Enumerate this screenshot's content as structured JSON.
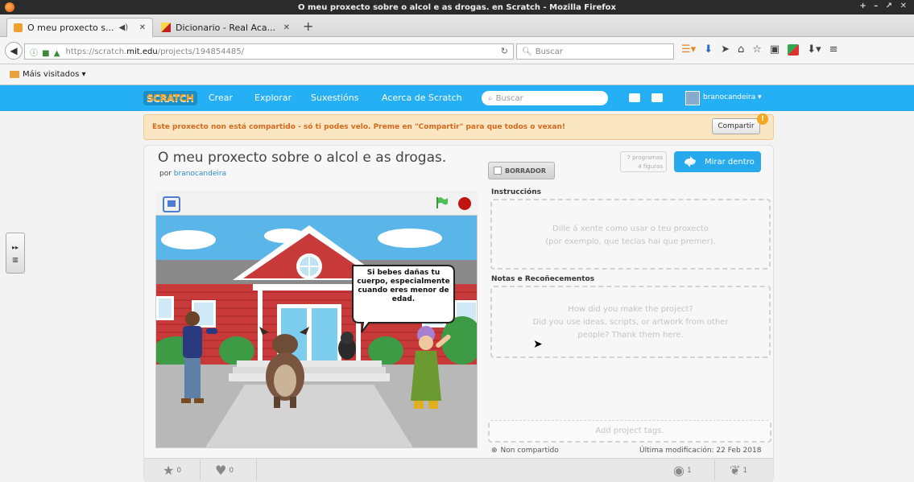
{
  "window": {
    "title": "O meu proxecto sobre o alcol e as drogas. en Scratch - Mozilla Firefox",
    "controls": "+ – ↗ ✕"
  },
  "tabs": [
    {
      "label": "O meu proxecto s...",
      "audio": "◀)",
      "close": "✕"
    },
    {
      "label": "Dicionario - Real Aca...",
      "close": "✕"
    }
  ],
  "new_tab": "+",
  "url": {
    "prefix": "https://scratch.",
    "host": "mit.edu",
    "path": "/projects/194854485/"
  },
  "browser_search": {
    "placeholder": "Buscar"
  },
  "bookmarks": {
    "label": "Máis visitados ▾"
  },
  "scratch_nav": {
    "logo": "SCRATCH",
    "links": [
      "Crear",
      "Explorar",
      "Suxestións",
      "Acerca de Scratch"
    ],
    "search_placeholder": "Buscar",
    "username": "branocandeira ▾"
  },
  "notice": {
    "text": "Este proxecto non está compartido - só ti podes velo. Preme en \"Compartir\" para que todos o vexan!",
    "share_button": "Compartir",
    "badge": "!"
  },
  "project": {
    "title": "O meu proxecto sobre o alcol e as drogas.",
    "by_prefix": "por",
    "author": "branocandeira",
    "draft_button": "BORRADOR",
    "scripts_count": "7 programas",
    "sprites_count": "4 figuras",
    "see_inside": "Mirar dentro",
    "speech_bubble": "Si bebes dañas tu cuerpo, especialmente cuando eres menor de edad."
  },
  "instructions": {
    "label": "Instruccións",
    "placeholder_line1": "Dille á xente como usar o teu proxecto",
    "placeholder_line2": "(por exemplo, que teclas hai que premer)."
  },
  "notes": {
    "label": "Notas e Recoñecementos",
    "placeholder_line1": "How did you make the project?",
    "placeholder_line2": "Did you use ideas, scripts, or artwork from other",
    "placeholder_line3": "people? Thank them here."
  },
  "tags": {
    "placeholder": "Add project tags."
  },
  "status": {
    "shared": "Non compartido",
    "modified": "Última modificación: 22 Feb 2018"
  },
  "stats": {
    "favorites": "0",
    "loves": "0",
    "views": "1",
    "remixes": "1"
  },
  "colors": {
    "scratch_blue": "#25aff4",
    "notice_bg": "#fbe6c4",
    "notice_text": "#d4691b",
    "see_inside_btn": "#26a9ed",
    "stop": "#c0150f",
    "flag": "#4cbf56"
  }
}
